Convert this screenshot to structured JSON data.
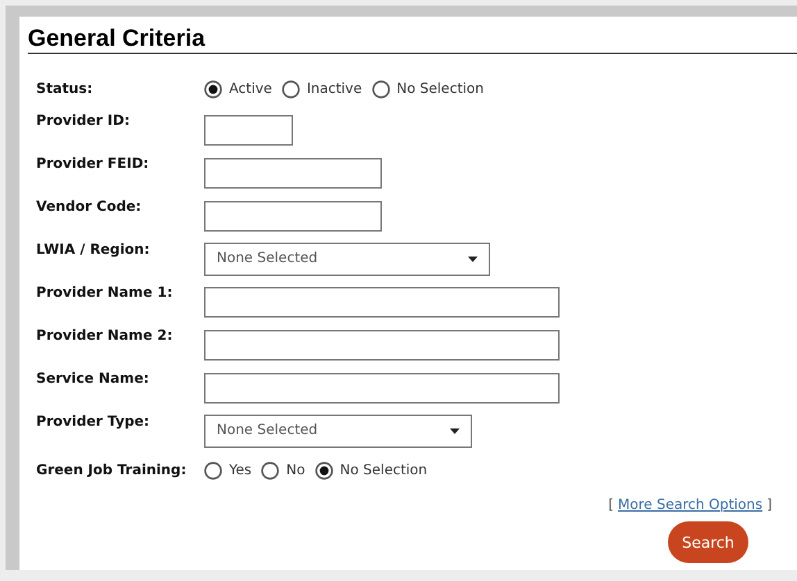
{
  "section": {
    "title": "General Criteria"
  },
  "fields": [
    {
      "label": "Status:",
      "kind": "radio",
      "options": [
        {
          "label": "Active",
          "selected": true
        },
        {
          "label": "Inactive",
          "selected": false
        },
        {
          "label": "No Selection",
          "selected": false
        }
      ]
    },
    {
      "label": "Provider ID:",
      "kind": "text-short"
    },
    {
      "label": "Provider FEID:",
      "kind": "text-medium"
    },
    {
      "label": "Vendor Code:",
      "kind": "text-medium"
    },
    {
      "label": "LWIA / Region:",
      "kind": "select-long",
      "value": "None Selected"
    },
    {
      "label": "Provider Name 1:",
      "kind": "text-long"
    },
    {
      "label": "Provider Name 2:",
      "kind": "text-long"
    },
    {
      "label": "Service Name:",
      "kind": "text-long"
    },
    {
      "label": "Provider Type:",
      "kind": "select-medium",
      "value": "None Selected"
    },
    {
      "label": "Green Job Training:",
      "kind": "radio",
      "options": [
        {
          "label": "Yes",
          "selected": false
        },
        {
          "label": "No",
          "selected": false
        },
        {
          "label": "No Selection",
          "selected": true
        }
      ]
    }
  ],
  "more_link": {
    "open": "[",
    "label": "More Search Options",
    "close": "]"
  },
  "search_button": "Search"
}
